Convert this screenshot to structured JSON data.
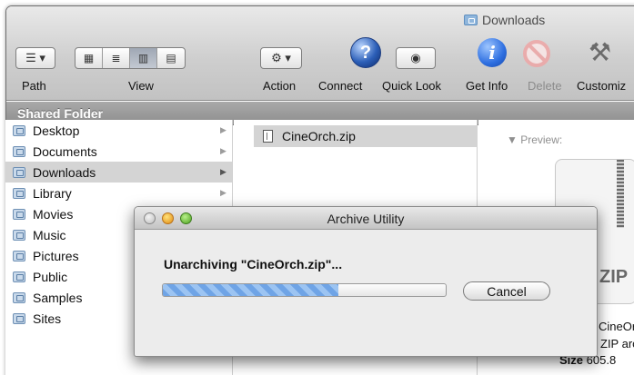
{
  "window": {
    "title": "Downloads"
  },
  "toolbar": {
    "path_label": "Path",
    "view_label": "View",
    "action_label": "Action",
    "connect_label": "Connect",
    "quicklook_label": "Quick Look",
    "getinfo_label": "Get Info",
    "delete_label": "Delete",
    "customize_label": "Customiz",
    "view_modes": [
      "icon-view",
      "list-view",
      "column-view",
      "coverflow-view"
    ],
    "selected_view": "column-view"
  },
  "sidebar_header": {
    "label": "Shared Folder"
  },
  "column1": {
    "items": [
      {
        "label": "Desktop",
        "selected": false
      },
      {
        "label": "Documents",
        "selected": false
      },
      {
        "label": "Downloads",
        "selected": true
      },
      {
        "label": "Library",
        "selected": false
      },
      {
        "label": "Movies",
        "selected": false
      },
      {
        "label": "Music",
        "selected": false
      },
      {
        "label": "Pictures",
        "selected": false
      },
      {
        "label": "Public",
        "selected": false
      },
      {
        "label": "Samples",
        "selected": false
      },
      {
        "label": "Sites",
        "selected": false
      }
    ]
  },
  "column2": {
    "file_name": "CineOrch.zip"
  },
  "preview": {
    "label": "▼ Preview:",
    "zip_label": "ZIP",
    "name_fragment": "CineOr",
    "kind_fragment": "ZIP arc",
    "size_key": "Size",
    "size_value": "605.8"
  },
  "dialog": {
    "title": "Archive Utility",
    "message": "Unarchiving \"CineOrch.zip\"...",
    "progress": 0.62,
    "cancel_label": "Cancel"
  }
}
